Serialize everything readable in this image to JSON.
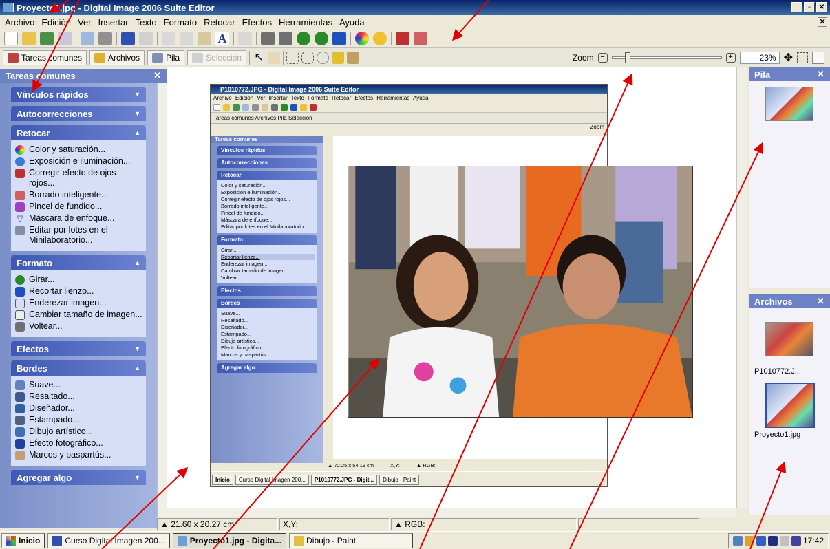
{
  "window": {
    "title": "Proyecto1.jpg - Digital Image 2006 Suite Editor"
  },
  "menu": [
    "Archivo",
    "Edición",
    "Ver",
    "Insertar",
    "Texto",
    "Formato",
    "Retocar",
    "Efectos",
    "Herramientas",
    "Ayuda"
  ],
  "panels": {
    "tareas": "Tareas comunes",
    "archivos": "Archivos",
    "pila": "Pila",
    "seleccion": "Selección"
  },
  "zoom": {
    "label": "Zoom",
    "value": "23%",
    "level_percent": 12
  },
  "left_pane": {
    "title": "Tareas comunes",
    "sections": {
      "vinculos": "Vínculos rápidos",
      "autocorrecciones": "Autocorrecciones",
      "retocar": {
        "title": "Retocar",
        "items": [
          "Color y saturación...",
          "Exposición e iluminación...",
          "Corregir efecto de ojos rojos...",
          "Borrado inteligente...",
          "Pincel de fundido...",
          "Máscara de enfoque...",
          "Editar por lotes en el Minilaboratorio..."
        ]
      },
      "formato": {
        "title": "Formato",
        "items": [
          "Girar...",
          "Recortar lienzo...",
          "Enderezar imagen...",
          "Cambiar tamaño de imagen...",
          "Voltear..."
        ]
      },
      "efectos": "Efectos",
      "bordes": {
        "title": "Bordes",
        "items": [
          "Suave...",
          "Resaltado...",
          "Diseñador...",
          "Estampado...",
          "Dibujo artístico...",
          "Efecto fotográfico...",
          "Marcos y paspartús..."
        ]
      },
      "agregar": "Agregar algo"
    }
  },
  "status": {
    "size": "▲ 21.60 x 20.27 cm",
    "xy": "X,Y:",
    "rgb": "▲ RGB:"
  },
  "inner": {
    "title": "P1010772.JPG - Digital Image 2006 Suite Editor",
    "menu": "Archivo  Edición  Ver  Insertar  Texto  Formato  Retocar  Efectos  Herramientas  Ayuda",
    "panels": "Tareas comunes   Archivos   Pila   Selección",
    "zoom": "Zoom",
    "status": {
      "size": "▲ 72.25 x 54.19 cm",
      "xy": "X,Y:",
      "rgb": "▲ RGB:"
    },
    "taskbar": [
      "Inicio",
      "Curso Digital Imagen 200...",
      "P1010772.JPG - Digit...",
      "Dibujo - Paint"
    ]
  },
  "right": {
    "pila_title": "Pila",
    "archivos_title": "Archivos",
    "files": [
      "P1010772.J...",
      "Proyecto1.jpg"
    ]
  },
  "taskbar": {
    "start": "Inicio",
    "items": [
      "Curso Digital Imagen 200...",
      "Proyecto1.jpg - Digita...",
      "Dibujo - Paint"
    ],
    "clock": "17:42"
  },
  "colors": {
    "accent": "#0a246a",
    "pane": "#7b8fc8",
    "annotation_arrows": "#e00000"
  }
}
